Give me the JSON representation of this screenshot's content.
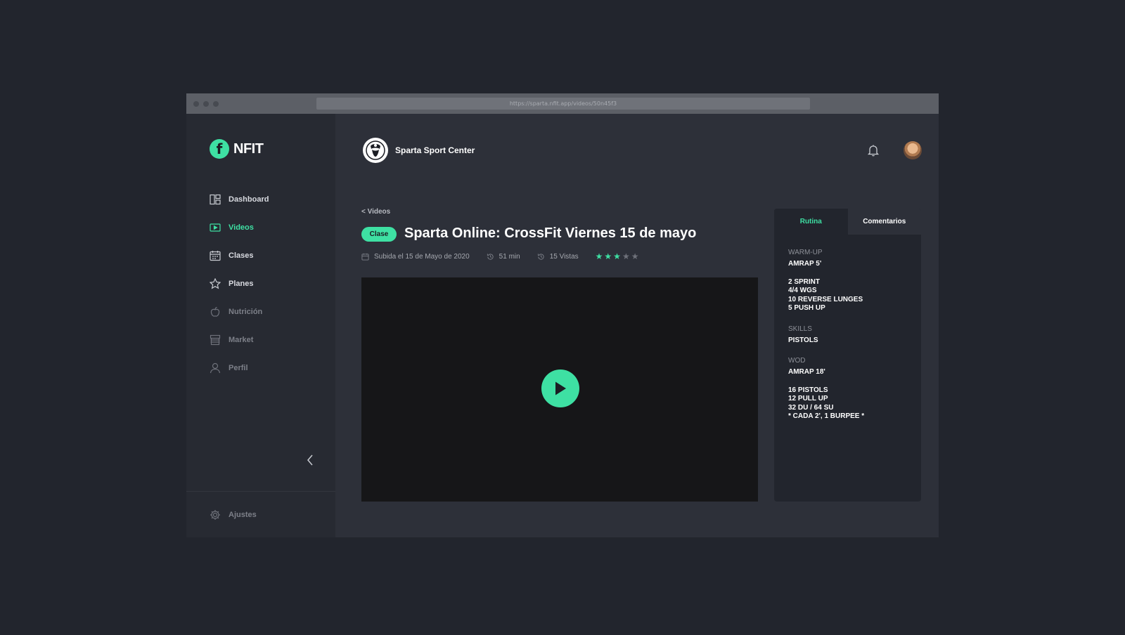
{
  "browser": {
    "url": "https://sparta.nfit.app/videos/50n45f3"
  },
  "sidebar": {
    "brand": {
      "mark": "f",
      "name": "NFIT"
    },
    "items": [
      {
        "label": "Dashboard",
        "icon": "dashboard-icon",
        "state": "normal"
      },
      {
        "label": "Videos",
        "icon": "video-icon",
        "state": "active"
      },
      {
        "label": "Clases",
        "icon": "calendar-icon",
        "state": "normal"
      },
      {
        "label": "Planes",
        "icon": "star-icon",
        "state": "normal"
      },
      {
        "label": "Nutrición",
        "icon": "apple-icon",
        "state": "disabled"
      },
      {
        "label": "Market",
        "icon": "store-icon",
        "state": "disabled"
      },
      {
        "label": "Perfil",
        "icon": "user-icon",
        "state": "disabled"
      }
    ],
    "collapse_icon": "chevron-left-icon",
    "settings_label": "Ajustes"
  },
  "header": {
    "org_name": "Sparta Sport Center",
    "notification_icon": "bell-icon",
    "avatar_icon": "user-avatar"
  },
  "video": {
    "back_label": "< Videos",
    "badge": "Clase",
    "title": "Sparta Online: CrossFit Viernes 15 de mayo",
    "uploaded": "Subida el 15 de Mayo de 2020",
    "duration": "51 min",
    "views": "15 Vistas",
    "rating": 3,
    "rating_max": 5
  },
  "panel": {
    "tabs": [
      "Rutina",
      "Comentarios"
    ],
    "active_tab": "Rutina",
    "routine": {
      "warmup_title": "WARM-UP",
      "warmup_head": "AMRAP 5'",
      "warmup_lines": [
        "2 SPRINT",
        "4/4 WGS",
        "10 REVERSE LUNGES",
        "5 PUSH UP"
      ],
      "skills_title": "SKILLS",
      "skills_line": "PISTOLS",
      "wod_title": "WOD",
      "wod_head": "AMRAP 18'",
      "wod_lines": [
        "16 PISTOLS",
        "12 PULL UP",
        "32 DU / 64 SU",
        "* CADA 2', 1 BURPEE *"
      ]
    }
  },
  "colors": {
    "accent": "#3ee0a3",
    "background": "#22252d",
    "surface": "#2d3039",
    "sidebar": "#272a32"
  }
}
